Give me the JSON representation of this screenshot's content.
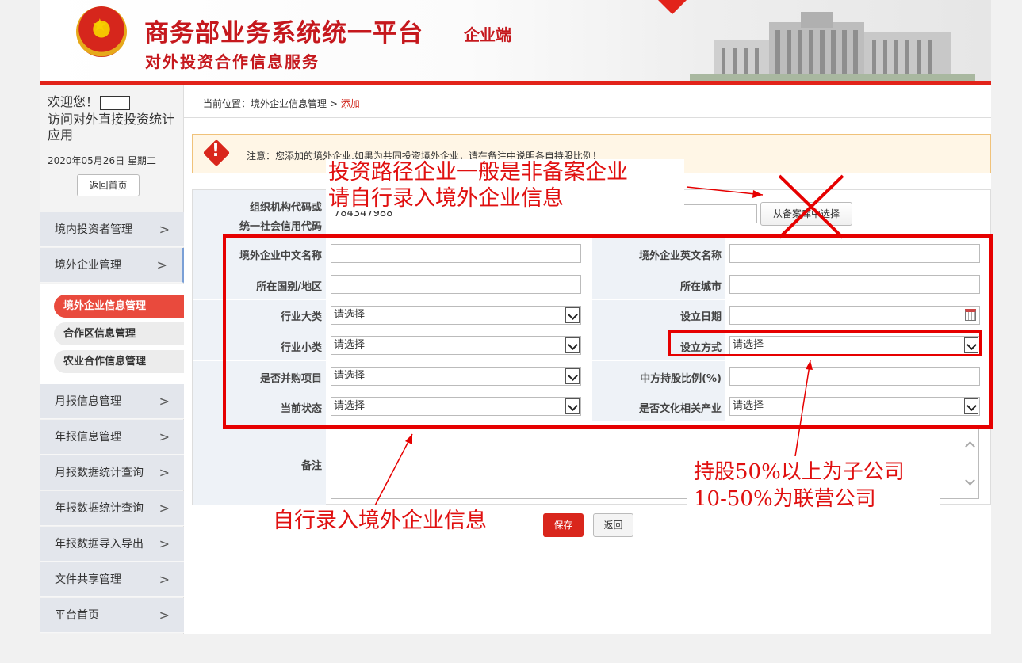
{
  "header": {
    "title": "商务部业务系统统一平台",
    "tag": "企业端",
    "subtitle": "对外投资合作信息服务"
  },
  "sidebar": {
    "welcome": "欢迎您！",
    "visit": "访问对外直接投资统计应用",
    "date": "2020年05月26日 星期二",
    "home_button": "返回首页",
    "menu": [
      {
        "label": "境内投资者管理"
      },
      {
        "label": "境外企业管理"
      },
      {
        "label": "月报信息管理"
      },
      {
        "label": "年报信息管理"
      },
      {
        "label": "月报数据统计查询"
      },
      {
        "label": "年报数据统计查询"
      },
      {
        "label": "年报数据导入导出"
      },
      {
        "label": "文件共享管理"
      },
      {
        "label": "平台首页"
      }
    ],
    "submenu": [
      {
        "label": "境外企业信息管理"
      },
      {
        "label": "合作区信息管理"
      },
      {
        "label": "农业合作信息管理"
      }
    ]
  },
  "breadcrumb": {
    "prefix": "当前位置：境外企业信息管理 > ",
    "current": "添加"
  },
  "notice": "注意：您添加的境外企业,如果为共同投资境外企业，请在备注中说明各自持股比例！",
  "form": {
    "org_code_label_1": "组织机构代码或",
    "org_code_label_2": "统一社会信用代码",
    "org_code_value": "784347988",
    "pick_button": "从备案库中选择",
    "cn_name_label": "境外企业中文名称",
    "en_name_label": "境外企业英文名称",
    "country_label": "所在国别/地区",
    "city_label": "所在城市",
    "industry_major_label": "行业大类",
    "industry_major_value": "请选择",
    "found_date_label": "设立日期",
    "industry_minor_label": "行业小类",
    "industry_minor_value": "请选择",
    "found_method_label": "设立方式",
    "found_method_value": "请选择",
    "merger_label": "是否并购项目",
    "merger_value": "请选择",
    "share_label": "中方持股比例(%)",
    "status_label": "当前状态",
    "status_value": "请选择",
    "culture_label": "是否文化相关产业",
    "culture_value": "请选择",
    "remark_label": "备注"
  },
  "buttons": {
    "save": "保存",
    "back": "返回"
  },
  "annotations": {
    "top_line1": "投资路径企业一般是非备案企业",
    "top_line2": "请自行录入境外企业信息",
    "bottom_left": "自行录入境外企业信息",
    "right_line1": "持股50%以上为子公司",
    "right_line2": "10-50%为联营公司"
  },
  "colors": {
    "brand_red": "#c5181d",
    "accent_red": "#e2231a",
    "annotation_red": "#e60000"
  }
}
